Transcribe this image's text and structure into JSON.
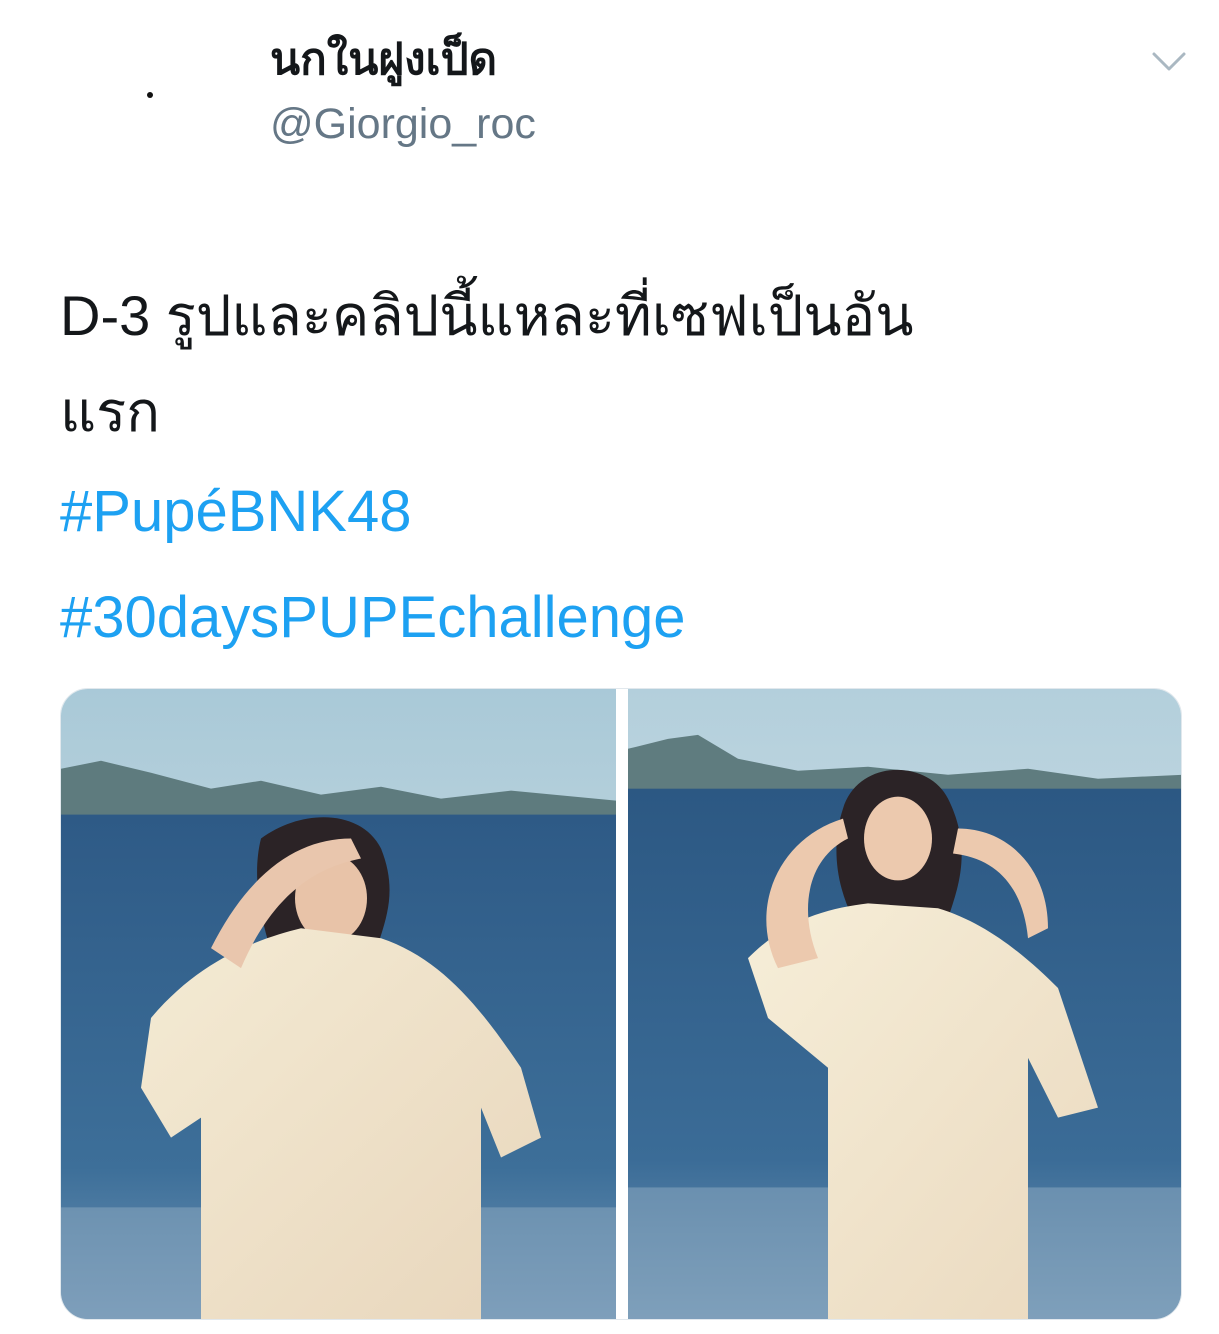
{
  "tweet": {
    "author": {
      "display_name": "นกในฝูงเป็ด",
      "handle": "@Giorgio_roc"
    },
    "text_line1": "D-3 รูปและคลิปนี้แหละที่เซฟเป็นอัน",
    "text_line2": "แรก",
    "hashtags": [
      "#PupéBNK48",
      "#30daysPUPEchallenge"
    ],
    "menu_icon": "chevron-down-icon",
    "media": [
      {
        "icon": "photo",
        "description_hidden": true
      },
      {
        "icon": "photo",
        "description_hidden": true
      }
    ]
  },
  "colors": {
    "text": "#14171a",
    "secondary": "#657786",
    "link": "#1da1f2",
    "chevron": "#aab8c2"
  }
}
